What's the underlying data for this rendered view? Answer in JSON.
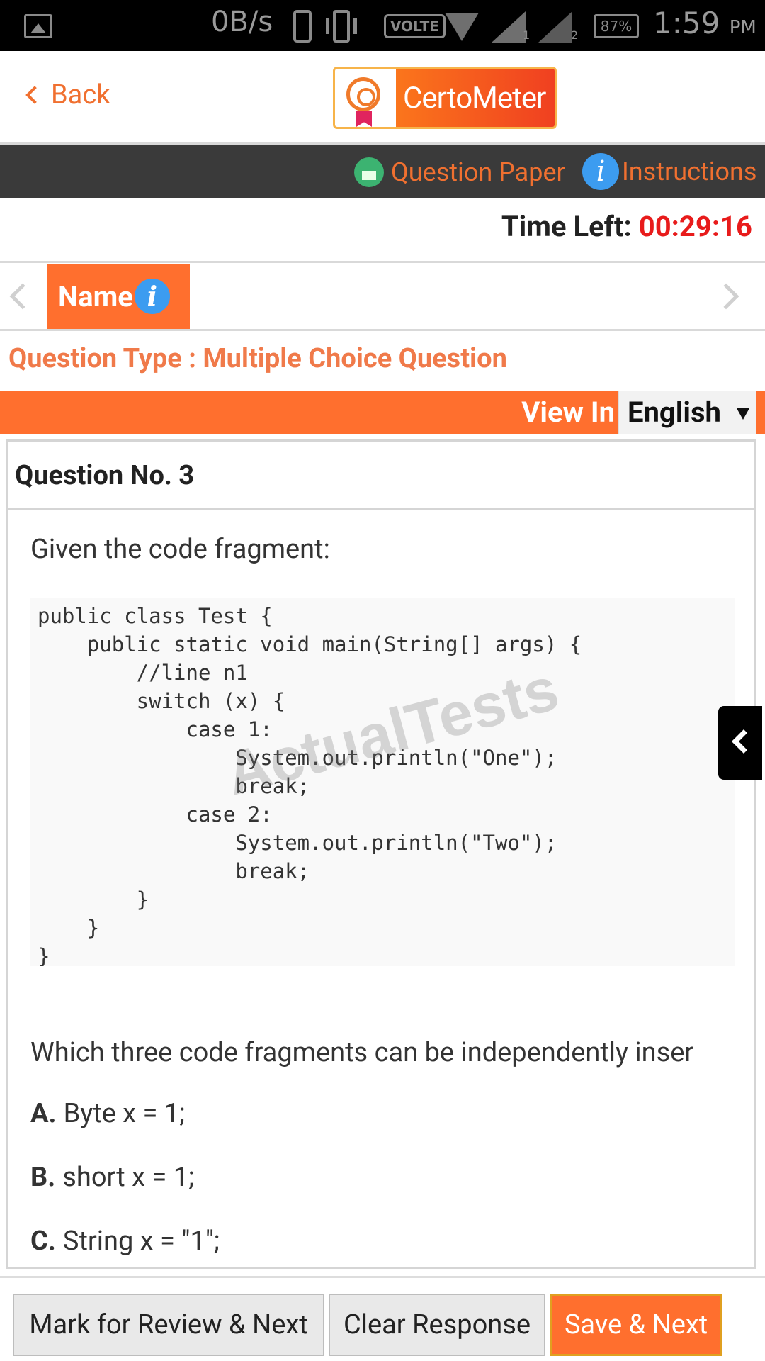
{
  "status_bar": {
    "net_speed": "0B/s",
    "volte": "VOLTE",
    "sim1": "1",
    "sim2": "2",
    "battery": "87%",
    "time": "1:59",
    "ampm": "PM"
  },
  "header": {
    "back_label": "Back",
    "logo_text": "CertoMeter"
  },
  "toolbar": {
    "question_paper": "Question Paper",
    "instructions": "Instructions",
    "info_glyph": "i"
  },
  "timer": {
    "label": "Time Left:",
    "value": "00:29:16"
  },
  "section": {
    "tab_label": "Name"
  },
  "question_type": "Question Type : Multiple Choice Question",
  "language": {
    "view_in": "View In",
    "selected": "English"
  },
  "question": {
    "number_label": "Question No. 3",
    "intro": "Given the code fragment:",
    "code": "public class Test {\n    public static void main(String[] args) {\n        //line n1\n        switch (x) {\n            case 1:\n                System.out.println(\"One\");\n                break;\n            case 2:\n                System.out.println(\"Two\");\n                break;\n        }\n    }\n}",
    "watermark": "ActualTests",
    "prompt": "Which three code fragments can be independently inser",
    "options": [
      {
        "letter": "A.",
        "text": "Byte x = 1;"
      },
      {
        "letter": "B.",
        "text": "short x = 1;"
      },
      {
        "letter": "C.",
        "text": "String x = \"1\";"
      }
    ]
  },
  "buttons": {
    "mark_review": "Mark for Review & Next",
    "clear": "Clear Response",
    "save_next": "Save & Next"
  },
  "colors": {
    "accent": "#ff6f2e",
    "timer_red": "#e81b1b",
    "dark_bar": "#3a3a3a",
    "info_blue": "#3c9cf0"
  }
}
